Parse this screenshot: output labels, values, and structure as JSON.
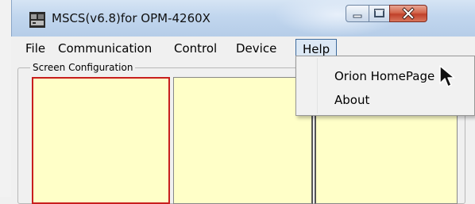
{
  "window": {
    "title": "MSCS(v6.8)for OPM-4260X",
    "icon": "app-icon",
    "controls": {
      "minimize_icon": "minimize-icon",
      "maximize_icon": "maximize-icon",
      "close_icon": "close-icon"
    }
  },
  "menubar": {
    "items": [
      {
        "label": "File"
      },
      {
        "label": "Communication"
      },
      {
        "label": "Control"
      },
      {
        "label": "Device"
      },
      {
        "label": "Help",
        "active": true
      }
    ]
  },
  "help_menu": {
    "items": [
      {
        "label": "Orion HomePage"
      },
      {
        "label": "About"
      }
    ]
  },
  "screen_config": {
    "label": "Screen Configuration",
    "panel_color": "#ffffc8",
    "selected_border_color": "#c81e1e"
  },
  "colors": {
    "titlebar": "#c1d6ee",
    "close_button": "#c0402a"
  }
}
